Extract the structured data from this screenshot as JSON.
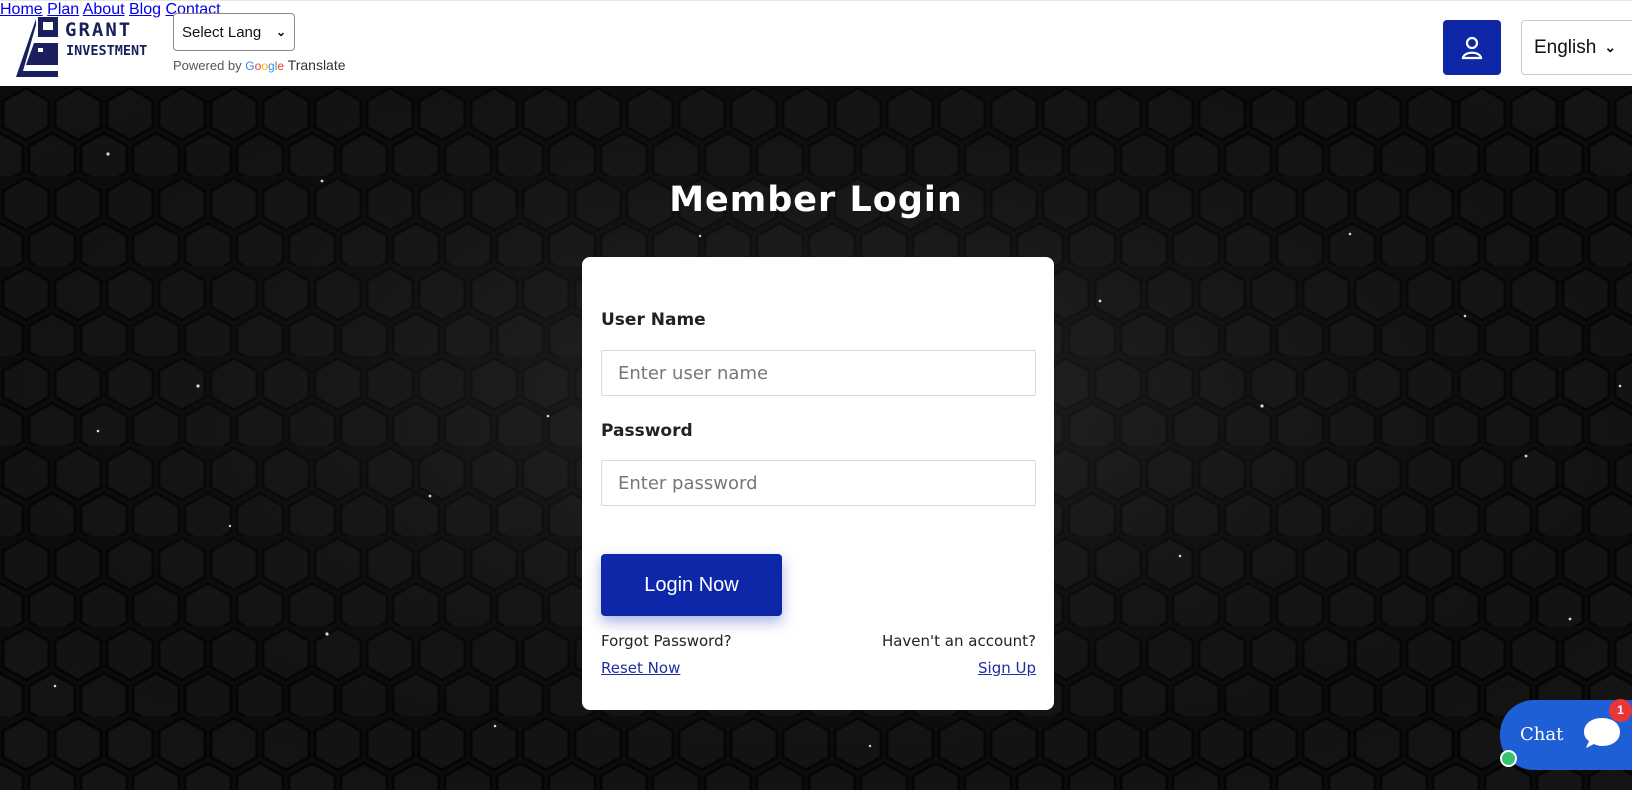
{
  "brand": {
    "line1": "GRANT",
    "line2": "INVESTMENT"
  },
  "translate": {
    "select_value": "Select Lang",
    "powered_prefix": "Powered by",
    "google": [
      "G",
      "o",
      "o",
      "g",
      "l",
      "e"
    ],
    "suffix": "Translate"
  },
  "nav": {
    "items": [
      {
        "label": "Home"
      },
      {
        "label": "Plan"
      },
      {
        "label": "About"
      },
      {
        "label": "Blog"
      },
      {
        "label": "Contact"
      }
    ]
  },
  "header_right": {
    "user_icon": "user-icon",
    "language": "English"
  },
  "login": {
    "title": "Member Login",
    "username_label": "User Name",
    "username_placeholder": "Enter user name",
    "password_label": "Password",
    "password_placeholder": "Enter password",
    "submit_label": "Login Now",
    "forgot_text": "Forgot Password?",
    "reset_link": "Reset Now",
    "no_account_text": "Haven't an account?",
    "signup_link": "Sign Up"
  },
  "chat": {
    "label": "Chat",
    "badge": "1",
    "icon": "chat-bubble-icon"
  },
  "colors": {
    "primary": "#0d27a8",
    "nav_text": "#1f2fa0",
    "chat": "#1f5fd6",
    "badge": "#e8353a",
    "online": "#35c46b"
  }
}
